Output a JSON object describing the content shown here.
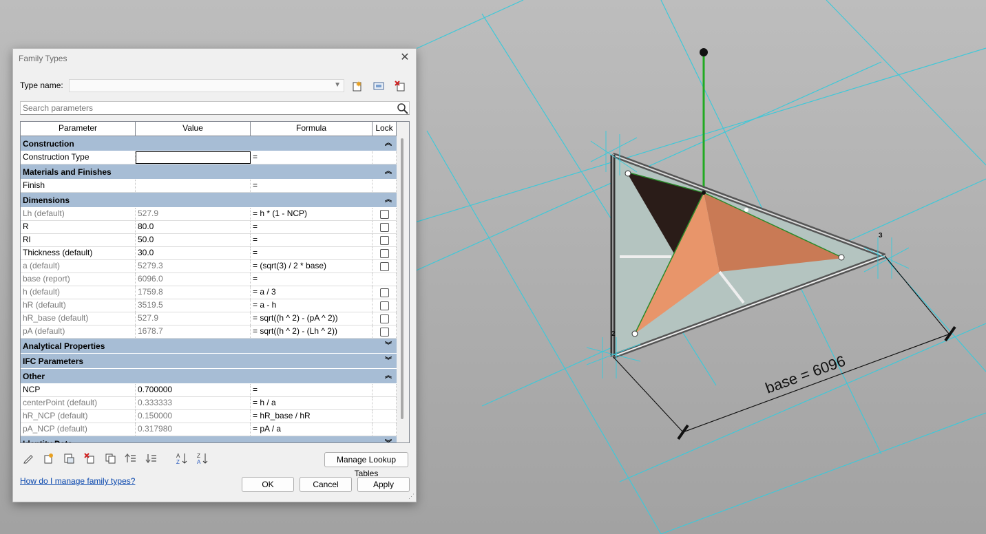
{
  "dialog": {
    "title": "Family Types",
    "type_name_label": "Type name:",
    "type_name_value": "",
    "search_placeholder": "Search parameters",
    "columns": [
      "Parameter",
      "Value",
      "Formula",
      "Lock"
    ],
    "groups": [
      {
        "label": "Construction",
        "expanded": true,
        "rows": [
          {
            "name": "Construction Type",
            "value": "",
            "formula": "=",
            "lock": null,
            "gray": false,
            "editing": true
          }
        ]
      },
      {
        "label": "Materials and Finishes",
        "expanded": true,
        "rows": [
          {
            "name": "Finish",
            "value": "",
            "formula": "=",
            "lock": null,
            "gray": false
          }
        ]
      },
      {
        "label": "Dimensions",
        "expanded": true,
        "rows": [
          {
            "name": "Lh (default)",
            "value": "527.9",
            "formula": "= h * (1 - NCP)",
            "lock": false,
            "gray": true
          },
          {
            "name": "R",
            "value": "80.0",
            "formula": "=",
            "lock": false,
            "gray": false
          },
          {
            "name": "Rl",
            "value": "50.0",
            "formula": "=",
            "lock": false,
            "gray": false
          },
          {
            "name": "Thickness (default)",
            "value": "30.0",
            "formula": "=",
            "lock": false,
            "gray": false
          },
          {
            "name": "a (default)",
            "value": "5279.3",
            "formula": "= (sqrt(3) / 2 * base)",
            "lock": false,
            "gray": true
          },
          {
            "name": "base (report)",
            "value": "6096.0",
            "formula": "=",
            "lock": null,
            "gray": true
          },
          {
            "name": "h (default)",
            "value": "1759.8",
            "formula": "= a / 3",
            "lock": false,
            "gray": true
          },
          {
            "name": "hR (default)",
            "value": "3519.5",
            "formula": "= a - h",
            "lock": false,
            "gray": true
          },
          {
            "name": "hR_base (default)",
            "value": "527.9",
            "formula": "= sqrt((h ^ 2) - (pA ^ 2))",
            "lock": false,
            "gray": true
          },
          {
            "name": "pA (default)",
            "value": "1678.7",
            "formula": "= sqrt((h ^ 2) - (Lh ^ 2))",
            "lock": false,
            "gray": true
          }
        ]
      },
      {
        "label": "Analytical Properties",
        "expanded": false,
        "rows": []
      },
      {
        "label": "IFC Parameters",
        "expanded": false,
        "rows": []
      },
      {
        "label": "Other",
        "expanded": true,
        "rows": [
          {
            "name": "NCP",
            "value": "0.700000",
            "formula": "=",
            "lock": null,
            "gray": false
          },
          {
            "name": "centerPoint (default)",
            "value": "0.333333",
            "formula": "= h / a",
            "lock": null,
            "gray": true
          },
          {
            "name": "hR_NCP (default)",
            "value": "0.150000",
            "formula": "= hR_base / hR",
            "lock": null,
            "gray": true
          },
          {
            "name": "pA_NCP (default)",
            "value": "0.317980",
            "formula": "= pA / a",
            "lock": null,
            "gray": true
          }
        ]
      },
      {
        "label": "Identity Data",
        "expanded": false,
        "rows": []
      }
    ],
    "manage_lookup_label": "Manage Lookup Tables",
    "help_link": "How do I manage family types?",
    "ok_label": "OK",
    "cancel_label": "Cancel",
    "apply_label": "Apply"
  },
  "viewport": {
    "dimension_label": "base = 6096",
    "point_labels": [
      "2",
      "3"
    ],
    "colors": {
      "background": "#a4a4a4",
      "grid_lines": "#3fc8d8",
      "reference_line": "#22aa22",
      "face_orange": "#e8956a",
      "face_dark": "#2a1c18",
      "face_glass": "#b4c4c0"
    }
  }
}
